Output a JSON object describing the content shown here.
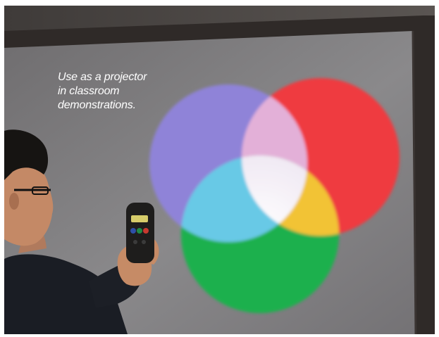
{
  "caption": {
    "lines": [
      "Use as a projector",
      "in classroom",
      "demonstrations."
    ]
  },
  "projection": {
    "circles": [
      {
        "name": "blue-light",
        "color": "#8f83d8"
      },
      {
        "name": "red-light",
        "color": "#ef3b3f"
      },
      {
        "name": "green-light",
        "color": "#1fb04e"
      }
    ],
    "overlap_colors": {
      "red_blue": "#e3b0d8",
      "blue_green": "#67c9e6",
      "red_green": "#f2c334",
      "all": "#f3eef6"
    }
  },
  "scene": {
    "screen_color": "#8f8e8f",
    "frame_color": "#2f2a28",
    "wall_color": "#58534f"
  }
}
